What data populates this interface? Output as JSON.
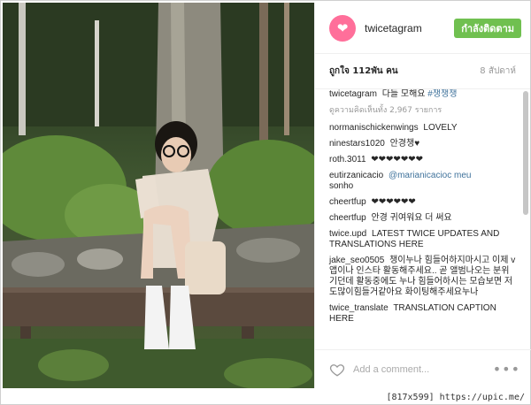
{
  "post": {
    "username": "twicetagram",
    "follow_label": "กำลังติดตาม",
    "likes": "ถูกใจ 112พัน คน",
    "age": "8 สัปดาห์",
    "view_more": "ดูความคิดเห็นทั้ง 2,967 รายการ",
    "comments": [
      {
        "user": "twicetagram",
        "text": "다들 모해요",
        "mention": "#챙챙챙"
      },
      {
        "user": "normanischickenwings",
        "text": "LOVELY"
      },
      {
        "user": "ninestars1020",
        "text": "안경챙♥"
      },
      {
        "user": "roth.3011",
        "text": "❤❤❤❤❤❤❤"
      },
      {
        "user": "eutirzanicacio",
        "text": "sonho",
        "mention": "@marianicacioc meu"
      },
      {
        "user": "cheertfup",
        "text": "❤❤❤❤❤❤"
      },
      {
        "user": "cheertfup",
        "text": "안경 귀여워요 더 써요"
      },
      {
        "user": "twice.upd",
        "text": "LATEST TWICE UPDATES AND TRANSLATIONS HERE"
      },
      {
        "user": "jake_seo0505",
        "text": "챙이누나 힘들어하지마시고 이제 v앱이나 인스타 활동해주세요.. 곧 앨범나오는 분위기던데 활동중에도 누나 힘들어하시는 모습보면 저도많이힘들거같아요 화이팅해주세요누나"
      },
      {
        "user": "twice_translate",
        "text": "TRANSLATION CAPTION HERE"
      }
    ],
    "add_comment_placeholder": "Add a comment..."
  },
  "watermark": "[817x599] https://upic.me/",
  "icons": {
    "avatar": "twice-logo-icon",
    "like": "heart-icon",
    "more": "more-options-icon"
  },
  "colors": {
    "follow": "#70c050",
    "avatar": "#ff6f9a",
    "link": "#3f729b"
  }
}
